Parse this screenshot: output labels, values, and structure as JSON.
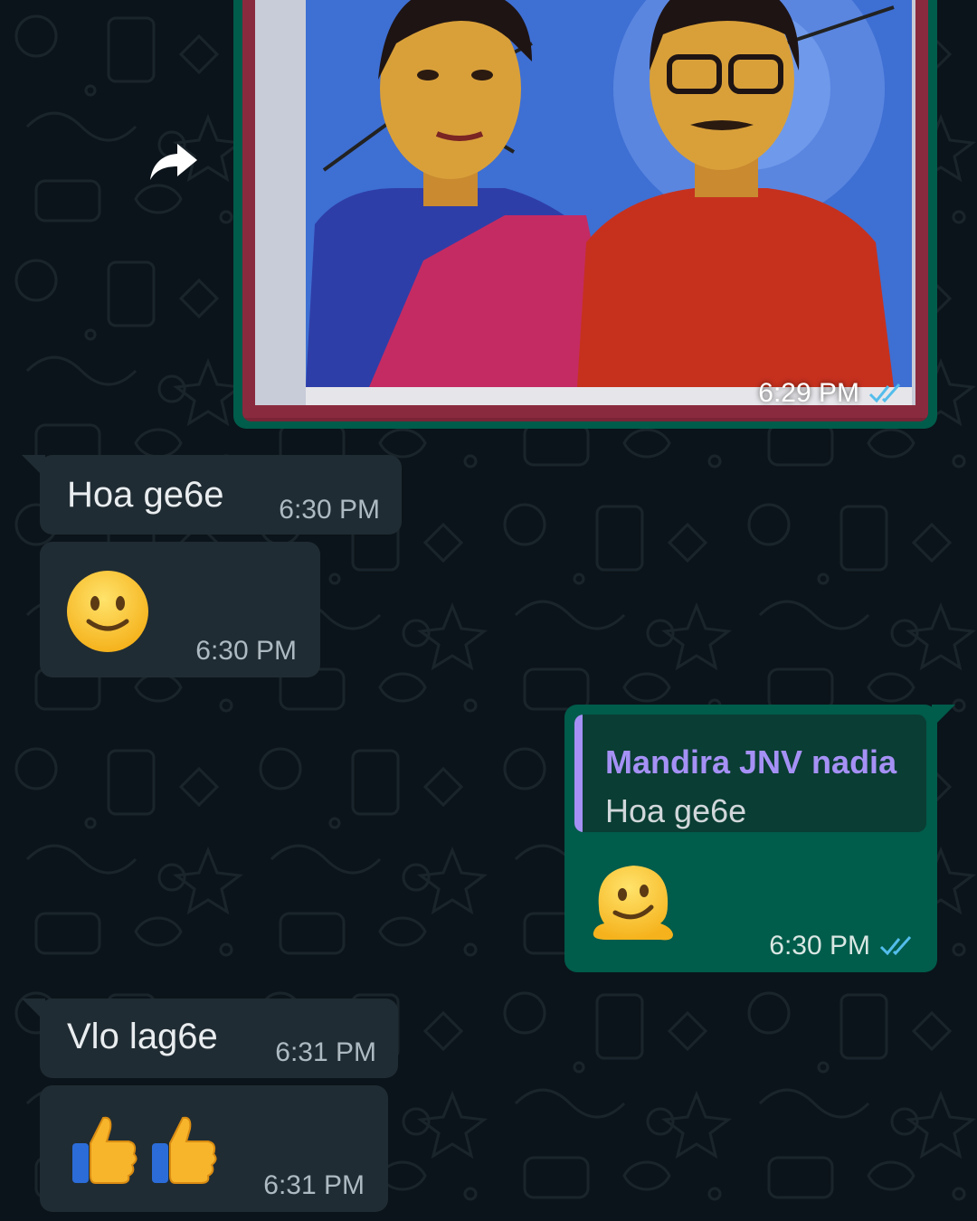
{
  "colors": {
    "background": "#0b141a",
    "incoming_bubble": "#202c33",
    "outgoing_bubble": "#005c4b",
    "quote_name": "#a591f5",
    "read_ticks": "#53bdeb"
  },
  "messages": [
    {
      "kind": "image",
      "direction": "outgoing",
      "time": "6:29 PM",
      "status": "read"
    },
    {
      "kind": "text",
      "direction": "incoming",
      "text": "Hoa ge6e",
      "time": "6:30 PM"
    },
    {
      "kind": "emoji",
      "direction": "incoming",
      "emoji": "slightly-smiling-face",
      "time": "6:30 PM"
    },
    {
      "kind": "reply",
      "direction": "outgoing",
      "quoted_sender": "Mandira JNV nadia",
      "quoted_text": "Hoa ge6e",
      "emoji": "melting-face",
      "time": "6:30 PM",
      "status": "read"
    },
    {
      "kind": "text",
      "direction": "incoming",
      "text": "Vlo lag6e",
      "time": "6:31 PM"
    },
    {
      "kind": "emoji",
      "direction": "incoming",
      "emoji": "thumbs-up thumbs-up",
      "time": "6:31 PM"
    }
  ],
  "icons": {
    "forward": "forward-arrow-icon",
    "read_receipt": "double-check-icon"
  }
}
